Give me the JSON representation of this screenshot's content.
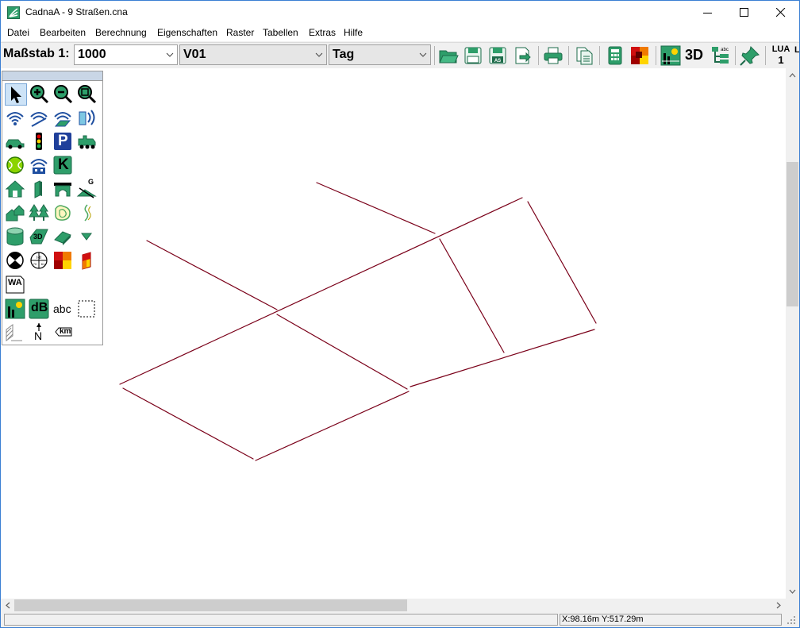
{
  "window": {
    "title": "CadnaA - 9 Straßen.cna"
  },
  "menu": [
    "Datei",
    "Bearbeiten",
    "Berechnung",
    "Eigenschaften",
    "Raster",
    "Tabellen",
    "Extras",
    "Hilfe"
  ],
  "toolbar": {
    "scale_label": "Maßstab 1:",
    "scale_value": "1000",
    "variant_value": "V01",
    "time_value": "Tag",
    "label_3d": "3D",
    "lua_label": "LUA",
    "lua_number": "1",
    "lua_cut": "L"
  },
  "palette": {
    "wa_label": "WA",
    "db_label": "dB",
    "abc_label": "abc",
    "km_label": "km",
    "north_label": "N",
    "k_label": "K",
    "p_label": "P",
    "label_3d_small": "3D",
    "g_label": "G"
  },
  "colors": {
    "street_line": "#7a0019",
    "accent_green": "#2e9e6a",
    "selection": "#cde3f7"
  },
  "status": {
    "coordinates": "X:98.16m Y:517.29m"
  }
}
